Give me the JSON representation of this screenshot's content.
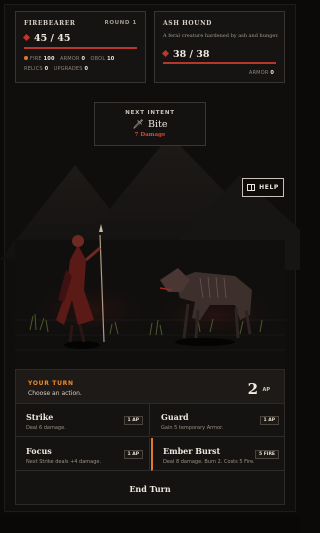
{
  "player": {
    "name": "FIREBEARER",
    "round": "ROUND 1",
    "hp": "45 / 45",
    "hp_fraction": 1.0,
    "stats": {
      "fire_label": "FIRE",
      "fire_value": "100",
      "armor_label": "ARMOR",
      "armor_value": "0",
      "obol_label": "OBOL",
      "obol_value": "10",
      "relics_label": "RELICS",
      "relics_value": "0",
      "upgrades_label": "UPGRADES",
      "upgrades_value": "0"
    }
  },
  "enemy": {
    "name": "ASH HOUND",
    "description": "A feral creature hardened by ash and hunger.",
    "hp": "38 / 38",
    "hp_fraction": 1.0,
    "armor_label": "ARMOR",
    "armor_value": "0"
  },
  "intent": {
    "label": "NEXT INTENT",
    "name": "Bite",
    "icon": "dagger-icon",
    "detail": "7 Damage"
  },
  "help_label": "HELP",
  "turn": {
    "title": "YOUR TURN",
    "subtitle": "Choose an action.",
    "ap_value": "2",
    "ap_unit": "AP",
    "actions": [
      {
        "name": "Strike",
        "desc": "Deal 6 damage.",
        "cost": "1 AP"
      },
      {
        "name": "Guard",
        "desc": "Gain 5 temporary Armor.",
        "cost": "1 AP"
      },
      {
        "name": "Focus",
        "desc": "Next Strike deals +4 damage.",
        "cost": "1 AP"
      },
      {
        "name": "Ember Burst",
        "desc": "Deal 8 damage. Burn 2. Costs 5 Fire.",
        "cost": "5 FIRE"
      }
    ],
    "end_label": "End Turn"
  },
  "colors": {
    "accent": "#e07a2a",
    "health": "#b8362b",
    "damage": "#d64a35"
  }
}
